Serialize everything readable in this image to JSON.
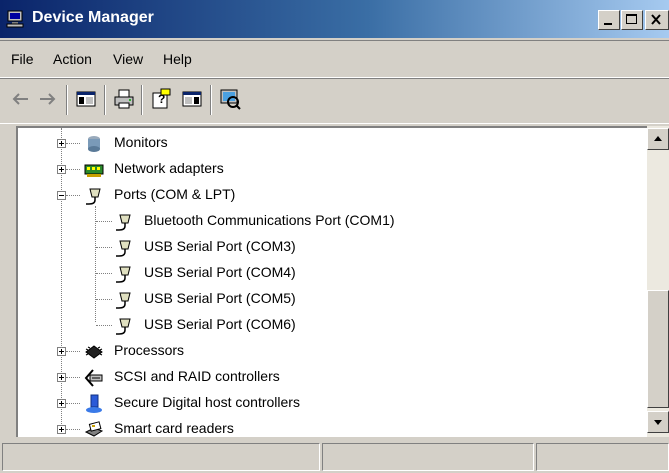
{
  "window": {
    "title": "Device Manager"
  },
  "title_buttons": {
    "minimize": "minimize",
    "maximize": "maximize",
    "close": "close"
  },
  "menu": [
    "File",
    "Action",
    "View",
    "Help"
  ],
  "toolbar": [
    "back",
    "forward",
    "show-hide-console-tree",
    "print",
    "properties",
    "help",
    "scan-for-hardware-changes"
  ],
  "tree": {
    "monitors": "Monitors",
    "network_adapters": "Network adapters",
    "ports": "Ports (COM & LPT)",
    "port_children": [
      "Bluetooth Communications Port (COM1)",
      "USB Serial Port (COM3)",
      "USB Serial Port (COM4)",
      "USB Serial Port (COM5)",
      "USB Serial Port (COM6)"
    ],
    "processors": "Processors",
    "scsi_raid": "SCSI and RAID controllers",
    "secure_digital": "Secure Digital host controllers",
    "smart_card": "Smart card readers"
  },
  "status_bar": {
    "panels": [
      "",
      "",
      ""
    ]
  },
  "colors": {
    "title_start": "#0a246a",
    "title_end": "#a6caf0",
    "chrome": "#d4d0c8"
  }
}
